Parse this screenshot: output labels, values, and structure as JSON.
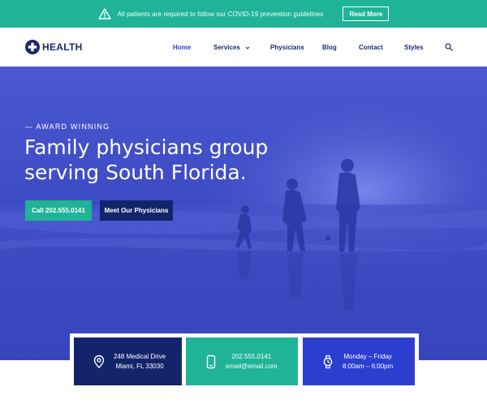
{
  "alert": {
    "icon": "warning-triangle-icon",
    "text": "All patients are required to follow our COVID-19 prevention guidelines",
    "button_label": "Read More"
  },
  "header": {
    "logo_text": "HEALTH",
    "logo_icon": "plus-circle-icon",
    "nav": [
      {
        "label": "Home",
        "active": true
      },
      {
        "label": "Services",
        "has_dropdown": true
      },
      {
        "label": "Physicians"
      },
      {
        "label": "Blog"
      },
      {
        "label": "Contact"
      },
      {
        "label": "Styles"
      }
    ],
    "search_icon": "search-icon"
  },
  "hero": {
    "eyebrow": "— AWARD WINNING",
    "headline_line1": "Family physicians group",
    "headline_line2": "serving South Florida.",
    "call_button": "Call 202.555.0141",
    "meet_button": "Meet Our Physicians"
  },
  "cards": {
    "address": {
      "line1": "248 Medical Drive",
      "line2": "Miami, FL 33030",
      "icon": "map-pin-icon"
    },
    "phone": {
      "line1": "202.555.0141",
      "line2": "email@email.com",
      "icon": "phone-icon"
    },
    "hours": {
      "line1": "Monday – Friday",
      "line2": "8:00am – 6:00pm",
      "icon": "watch-icon"
    }
  },
  "colors": {
    "teal": "#1fb397",
    "navy": "#14246b",
    "blue": "#2c3ed0",
    "hero_overlay": "#3d4bc6"
  }
}
